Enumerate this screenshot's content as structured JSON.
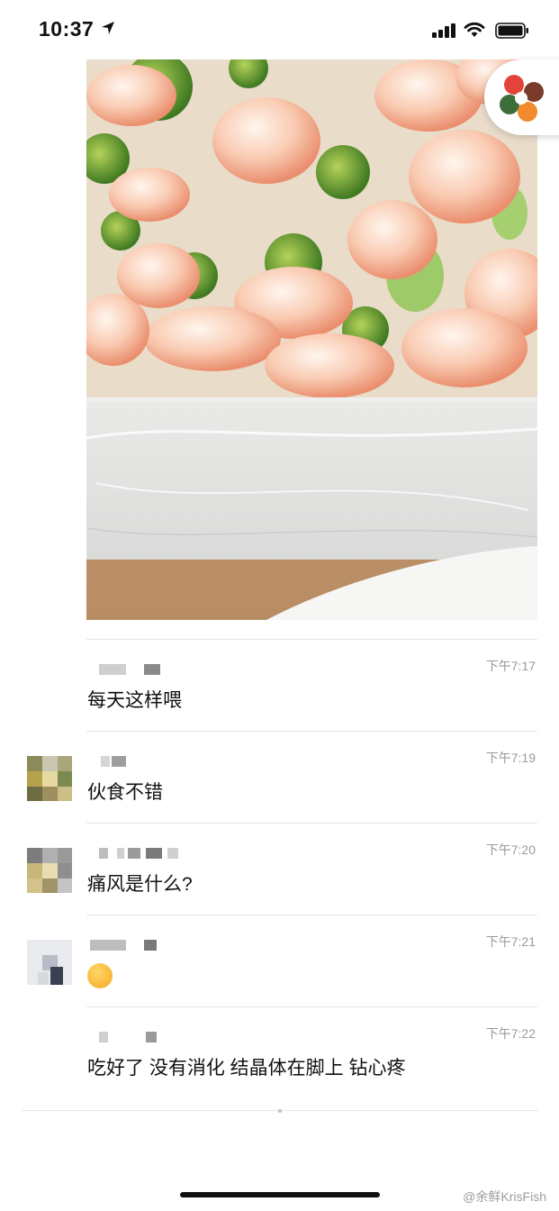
{
  "status_bar": {
    "time": "10:37"
  },
  "post": {
    "photo_description": "meal-photo"
  },
  "comments": [
    {
      "time": "下午7:17",
      "text": "每天这样喂"
    },
    {
      "time": "下午7:19",
      "text": "伙食不错"
    },
    {
      "time": "下午7:20",
      "text": "痛风是什么?"
    },
    {
      "time": "下午7:21",
      "text": ""
    },
    {
      "time": "下午7:22",
      "text": "吃好了 没有消化 结晶体在脚上 钻心疼"
    }
  ],
  "watermark": "@余鲜KrisFish",
  "colors": {
    "divider": "#e6e6e6",
    "time_text": "#9a9a9a",
    "body_text": "#111111"
  },
  "icons": [
    "location-arrow-icon",
    "signal-icon",
    "wifi-icon",
    "battery-icon",
    "mini-program-icon",
    "emoji-icon"
  ]
}
